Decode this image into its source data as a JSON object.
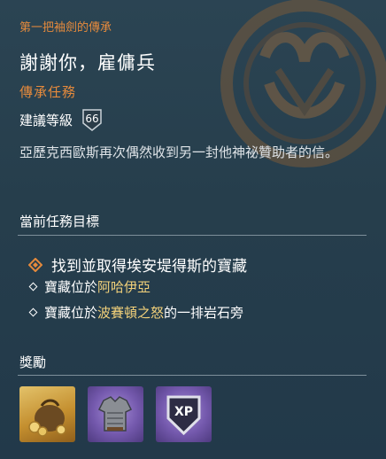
{
  "quest": {
    "line": "第一把袖劍的傳承",
    "title": "謝謝你，雇傭兵",
    "type": "傳承任務",
    "level_label": "建議等級",
    "level": "66",
    "description": "亞歷克西歐斯再次偶然收到另一封他神祕贊助者的信。"
  },
  "objectives": {
    "heading": "當前任務目標",
    "main": "找到並取得埃安堤得斯的寶藏",
    "sub": [
      {
        "prefix": "寶藏位於",
        "highlight": "阿哈伊亞",
        "suffix": ""
      },
      {
        "prefix": "寶藏位於",
        "highlight": "波賽頓之怒",
        "suffix": "的一排岩石旁"
      }
    ]
  },
  "rewards": {
    "heading": "獎勵",
    "items": [
      {
        "icon": "drachmae-pouch-icon",
        "color": "#d6b25a"
      },
      {
        "icon": "chest-armor-icon",
        "color": "#8b72c4"
      },
      {
        "icon": "xp-shield-icon",
        "label": "XP",
        "color": "#8b72c4"
      }
    ]
  },
  "colors": {
    "accent_orange": "#e58a3c",
    "highlight_yellow": "#f2d17a",
    "background": "#263e4c",
    "epic_purple": "#7459ad",
    "legendary_gold": "#c48f2f"
  }
}
